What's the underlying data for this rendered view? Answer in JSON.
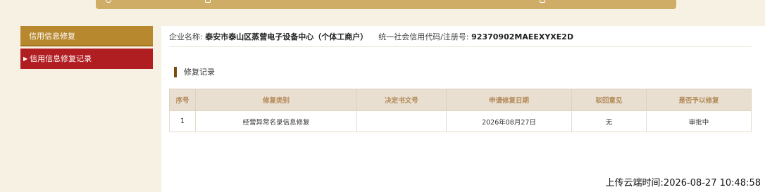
{
  "sidebar": {
    "items": [
      {
        "label": "信用信息修复"
      },
      {
        "label": "信用信息修复记录"
      }
    ]
  },
  "company": {
    "name_label": "企业名称:",
    "name": "泰安市泰山区蒸营电子设备中心（个体工商户）",
    "code_label": "统一社会信用代码/注册号:",
    "code": "92370902MAEEXYXE2D"
  },
  "section": {
    "title": "修复记录"
  },
  "table": {
    "headers": [
      "序号",
      "修复类别",
      "决定书文号",
      "申请修复日期",
      "驳回意见",
      "是否予以修复"
    ],
    "rows": [
      [
        "1",
        "经营异常名录信息修复",
        "",
        "2026年08月27日",
        "无",
        "审批中"
      ]
    ]
  },
  "footer": {
    "upload_time": "上传云端时间:2026-08-27 10:48:58"
  },
  "colors": {
    "gold": "#b8882f",
    "red": "#b11e22",
    "header_bg": "#e9dfd0",
    "header_text": "#b38a5a"
  }
}
